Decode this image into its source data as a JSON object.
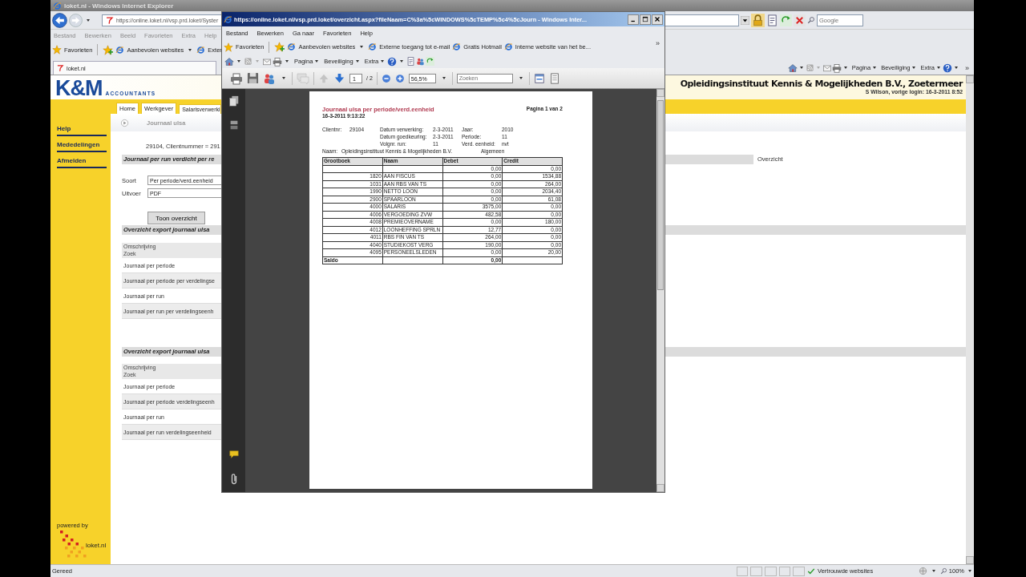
{
  "main_window": {
    "title": "loket.nl - Windows Internet Explorer",
    "address": "https://online.loket.nl/vsp.prd.loket/Syster",
    "search_placeholder": "Google",
    "menu": [
      "Bestand",
      "Bewerken",
      "Beeld",
      "Favorieten",
      "Extra",
      "Help"
    ],
    "favorites": [
      {
        "label": "Favorieten",
        "kind": "favorites"
      },
      {
        "label": "Aanbevolen websites",
        "kind": "suggested"
      },
      {
        "label": "Exter",
        "kind": "link"
      }
    ],
    "tab": "loket.nl",
    "command_menus": [
      "Pagina",
      "Beveiliging",
      "Extra"
    ],
    "more": "»"
  },
  "page": {
    "logo": "K&M",
    "logo_tagline": "ACCOUNTANTS",
    "company": "Opleidingsinstituut Kennis & Mogelijkheden B.V., Zoetermeer",
    "login": "S Wilson, vorige login: 16-3-2011 8:52",
    "nav_tabs": [
      "Home",
      "Werkgever",
      "Salarisverwerki"
    ],
    "sidebar": [
      "Help",
      "Mededelingen",
      "Afmelden"
    ],
    "powered_by": "powered by",
    "powered_logo": "loket.nl",
    "heading": "Journaal ulsa",
    "client_info": "29104, Clientnummer = 291",
    "form_title": "Journaal per run verdicht per re",
    "side_link": "Overzicht",
    "fields": [
      {
        "label": "Soort",
        "value": "Per periode/verd.eenheid"
      },
      {
        "label": "Uitvoer",
        "value": "PDF"
      }
    ],
    "submit": "Toon overzicht",
    "exports": [
      {
        "title": "Overzicht export journaal ulsa",
        "columns": [
          "Omschrijving",
          "Zoek"
        ],
        "rows": [
          "Journaal per periode",
          "Journaal per periode per verdelingse",
          "Journaal per run",
          "Journaal per run per verdelingseenh"
        ]
      },
      {
        "title": "Overzicht export journaal ulsa",
        "columns": [
          "Omschrijving",
          "Zoek"
        ],
        "rows": [
          "Journaal per periode",
          "Journaal per periode verdelingseenh",
          "Journaal per run",
          "Journaal per run verdelingseenheid"
        ]
      }
    ]
  },
  "popup": {
    "title": "https://online.loket.nl/vsp.prd.loket/overzicht.aspx?fileNaam=C%3a%5cWINDOWS%5cTEMP%5c4%5cJourn - Windows Inter...",
    "menu": [
      "Bestand",
      "Bewerken",
      "Ga naar",
      "Favorieten",
      "Help"
    ],
    "favorites": [
      {
        "label": "Favorieten",
        "kind": "favorites"
      },
      {
        "label": "Aanbevolen websites",
        "kind": "suggested"
      },
      {
        "label": "Externe toegang tot e-mail",
        "kind": "link"
      },
      {
        "label": "Gratis Hotmail",
        "kind": "link"
      },
      {
        "label": "Interne website van het be...",
        "kind": "link"
      }
    ],
    "more": "»",
    "command_menus": [
      "Pagina",
      "Beveiliging",
      "Extra"
    ],
    "page_number": "1",
    "page_count": "/ 2",
    "zoom": "56,5%",
    "search_placeholder": "Zoeken",
    "document": {
      "title": "Journaal ulsa per periode/verd.eenheid",
      "timestamp": "16-3-2011 9:13:22",
      "page_label": "Pagina 1 van 2",
      "info_rows": [
        [
          {
            "label": "Clientnr:",
            "value": "29104"
          },
          {
            "label": "Datum verwerking:",
            "value": "2-3-2011"
          },
          {
            "label": "Jaar:",
            "value": "2010"
          }
        ],
        [
          {
            "label": "Datum goedkeuring:",
            "value": "2-3-2011"
          },
          {
            "label": "Periode:",
            "value": "11"
          }
        ],
        [
          {
            "label": "Volgnr. run:",
            "value": "11"
          },
          {
            "label": "Verd. eenheid:",
            "value": "nvt"
          }
        ]
      ],
      "name_label": "Naam:",
      "name_value": "Opleidingsinstituut Kennis & Mogelijkheden B.V.",
      "unit": "Algemeen",
      "columns": [
        "Grootboek",
        "Naam",
        "Debet",
        "Credit"
      ],
      "rows": [
        {
          "debet": "0,00",
          "credit": "0,00"
        },
        {
          "account": "1820",
          "name": "AAN FISCUS",
          "debet": "0,00",
          "credit": "1534,88"
        },
        {
          "account": "1031",
          "name": "AAN RBS VAN TS",
          "debet": "0,00",
          "credit": "264,00"
        },
        {
          "account": "1990",
          "name": "NETTO LOON",
          "debet": "0,00",
          "credit": "2034,40"
        },
        {
          "account": "2900",
          "name": "SPAARLOON",
          "debet": "0,00",
          "credit": "61,08"
        },
        {
          "account": "4000",
          "name": "SALARIS",
          "debet": "3575,00",
          "credit": "0,00"
        },
        {
          "account": "4006",
          "name": "VERGOEDING ZVW",
          "debet": "482,58",
          "credit": "0,00"
        },
        {
          "account": "4008",
          "name": "PREMIEOVERNAME",
          "debet": "0,00",
          "credit": "180,00"
        },
        {
          "account": "4012",
          "name": "LOONHEFFING SPRLN",
          "debet": "12,77",
          "credit": "0,00"
        },
        {
          "account": "4011",
          "name": "RBS FIN VAN TS",
          "debet": "264,00",
          "credit": "0,00"
        },
        {
          "account": "4040",
          "name": "STUDIEKOST VERG",
          "debet": "190,00",
          "credit": "0,00"
        },
        {
          "account": "4095",
          "name": "PERSONEELSLEDEN",
          "debet": "0,00",
          "credit": "20,00"
        }
      ],
      "total": {
        "label": "Saldo",
        "debet": "0,00"
      }
    }
  },
  "status_bar": {
    "text": "Gereed",
    "zone": "Vertrouwde websites",
    "zoom": "100%"
  }
}
